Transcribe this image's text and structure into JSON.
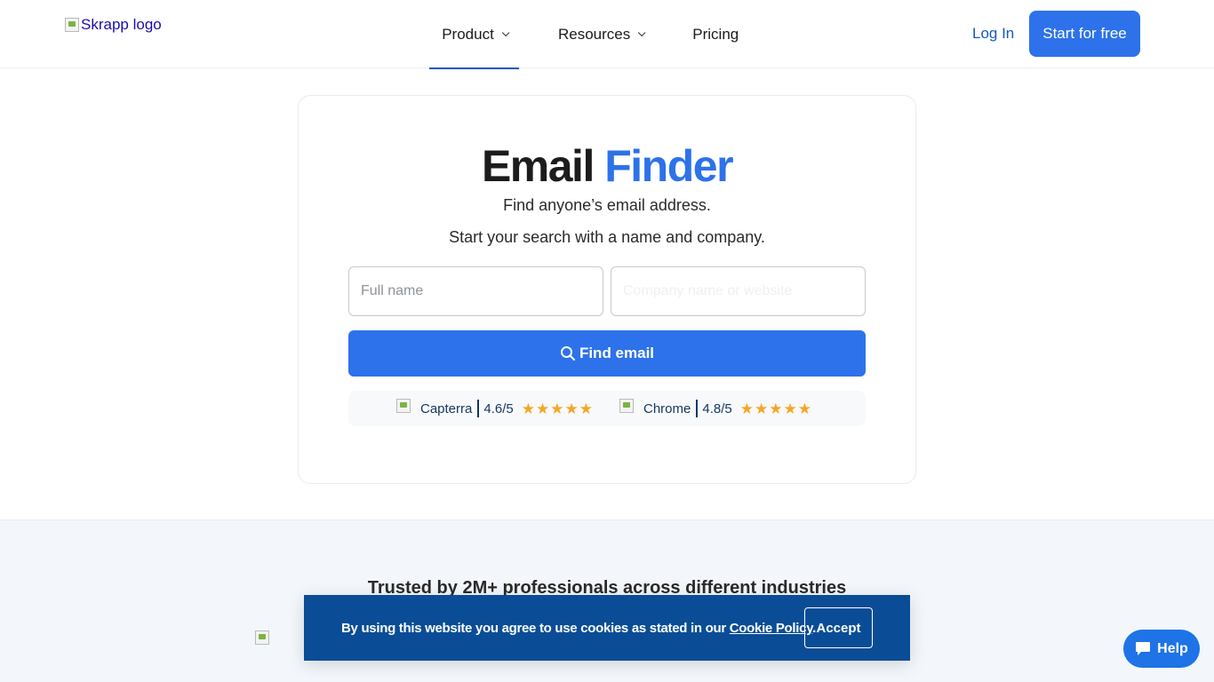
{
  "nav": {
    "logo_alt": "Skrapp logo",
    "items": [
      {
        "label": "Product",
        "has_dropdown": true,
        "active": true
      },
      {
        "label": "Resources",
        "has_dropdown": true,
        "active": false
      },
      {
        "label": "Pricing",
        "has_dropdown": false,
        "active": false
      }
    ],
    "login_label": "Log In",
    "start_label": "Start for free"
  },
  "hero": {
    "title_main": "Email",
    "title_accent": "Finder",
    "subtitle_1": "Find anyone’s email address.",
    "subtitle_2": "Start your search with a name and company.",
    "full_name_placeholder": "Full name",
    "company_placeholder": "Company name or website",
    "find_button_label": "Find email",
    "search_icon": "search-icon"
  },
  "ratings": [
    {
      "source": "Capterra",
      "score": "4.6/5",
      "stars": 5
    },
    {
      "source": "Chrome",
      "score": "4.8/5",
      "stars": 5
    }
  ],
  "trusted": {
    "title": "Trusted by 2M+ professionals across different industries"
  },
  "cookie": {
    "text": "By using this website you agree to use cookies as stated in our ",
    "link_label": "Cookie Policy",
    "suffix": ".",
    "accept_label": "Accept"
  },
  "help": {
    "label": "Help",
    "icon": "chat-icon"
  },
  "colors": {
    "accent": "#2d72ea",
    "nav_link": "#1557c0",
    "cookie_bg": "#0a4d96",
    "star": "#f5a623",
    "rating_text": "#12375e"
  }
}
